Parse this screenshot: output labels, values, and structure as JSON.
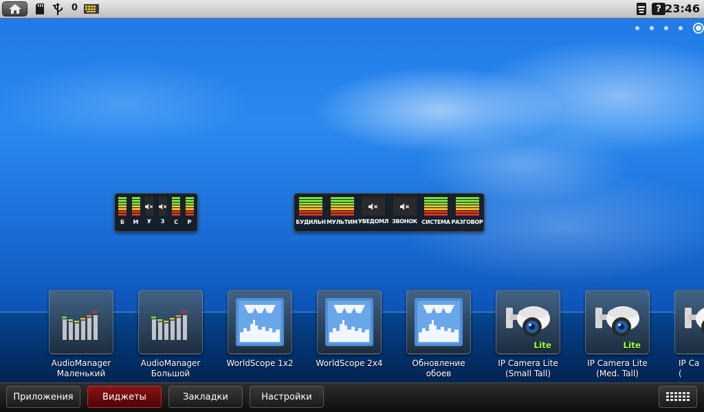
{
  "status_bar": {
    "notification_count": "0",
    "time": "23:46",
    "help_label": "?"
  },
  "pager": {
    "pages": 5,
    "active_index": 4
  },
  "widget_small": {
    "channels": [
      {
        "label": "Б",
        "muted": false
      },
      {
        "label": "М",
        "muted": false
      },
      {
        "label": "У",
        "muted": true
      },
      {
        "label": "З",
        "muted": true
      },
      {
        "label": "С",
        "muted": false
      },
      {
        "label": "Р",
        "muted": false
      }
    ]
  },
  "widget_large": {
    "channels": [
      {
        "label": "БУДИЛЬН",
        "muted": false
      },
      {
        "label": "МУЛЬТИМ",
        "muted": false
      },
      {
        "label": "УВЕДОМЛ",
        "muted": true
      },
      {
        "label": "ЗВОНОК",
        "muted": true
      },
      {
        "label": "СИСТЕМА",
        "muted": false
      },
      {
        "label": "РАЗГОВОР",
        "muted": false
      }
    ]
  },
  "drawer": {
    "items": [
      {
        "line1": "AudioManager",
        "line2": "Маленький",
        "icon": "equalizer-icon"
      },
      {
        "line1": "AudioManager",
        "line2": "Большой",
        "icon": "equalizer-icon"
      },
      {
        "line1": "WorldScope 1x2",
        "line2": "",
        "icon": "city-skyline-icon"
      },
      {
        "line1": "WorldScope 2x4",
        "line2": "",
        "icon": "city-skyline-icon"
      },
      {
        "line1": "Обновление",
        "line2": "обоев",
        "icon": "city-skyline-icon"
      },
      {
        "line1": "IP Camera Lite",
        "line2": "(Small Tall)",
        "icon": "security-camera-icon",
        "badge": "Lite"
      },
      {
        "line1": "IP Camera Lite",
        "line2": "(Med. Tall)",
        "icon": "security-camera-icon",
        "badge": "Lite"
      },
      {
        "line1": "IP Ca",
        "line2": "(",
        "icon": "security-camera-icon"
      }
    ]
  },
  "bottom_bar": {
    "tabs": [
      {
        "label": "Приложения",
        "active": false
      },
      {
        "label": "Виджеты",
        "active": true
      },
      {
        "label": "Закладки",
        "active": false
      },
      {
        "label": "Настройки",
        "active": false
      }
    ]
  },
  "colors": {
    "meter_green": "#7ee03a",
    "meter_yellow": "#f2c21d",
    "meter_red": "#e0321d",
    "active_tab": "#8a1414"
  }
}
